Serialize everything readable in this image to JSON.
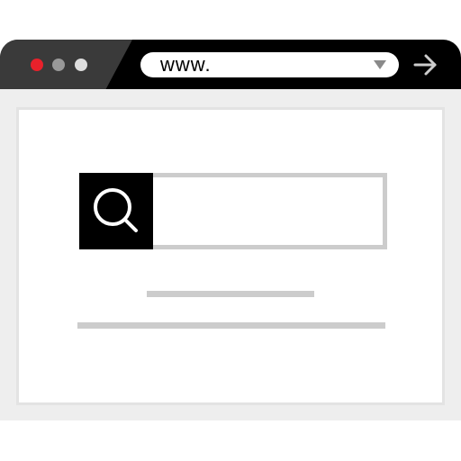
{
  "browser": {
    "url_text": "www.",
    "window_controls": {
      "close_color": "#e8212b",
      "minimize_color": "#999999",
      "maximize_color": "#dddddd"
    },
    "icons": {
      "url_dropdown": "caret-down-icon",
      "forward": "arrow-right-icon",
      "search": "search-icon"
    }
  },
  "colors": {
    "chrome_dark": "#000000",
    "chrome_gray": "#3a3a3a",
    "page_bg": "#eeeeee",
    "placeholder_line": "#cccccc"
  }
}
